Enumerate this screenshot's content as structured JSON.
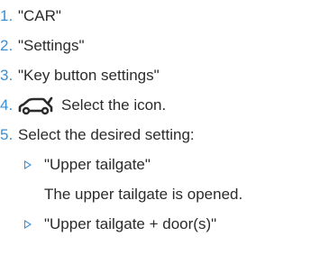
{
  "steps": [
    {
      "number": "1.",
      "text": "\"CAR\""
    },
    {
      "number": "2.",
      "text": "\"Settings\""
    },
    {
      "number": "3.",
      "text": "\"Key button settings\""
    },
    {
      "number": "4.",
      "icon": "car-tailgate-open-icon",
      "text": "Select the icon."
    },
    {
      "number": "5.",
      "text": "Select the desired setting:"
    }
  ],
  "options": [
    {
      "label": "\"Upper tailgate\"",
      "description": "The upper tailgate is opened."
    },
    {
      "label": "\"Upper tailgate + door(s)\""
    }
  ],
  "colors": {
    "accent": "#3a8fd6",
    "text": "#2b2b2b",
    "background": "#ffffff"
  }
}
